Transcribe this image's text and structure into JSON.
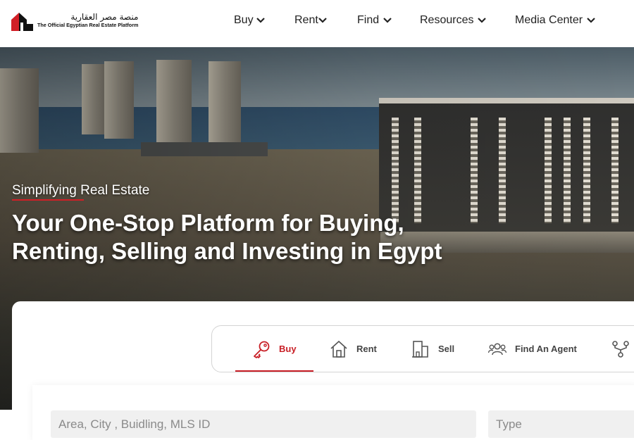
{
  "logo": {
    "arabic": "منصة مصر العقارية",
    "english": "The Official Egyptian Real Estate Platform"
  },
  "nav": {
    "items": [
      {
        "label": "Buy"
      },
      {
        "label": "Rent"
      },
      {
        "label": "Find"
      },
      {
        "label": "Resources"
      },
      {
        "label": "Media Center"
      }
    ]
  },
  "hero": {
    "kicker": "Simplifying Real Estate",
    "title_line1": "Your One-Stop Platform for Buying,",
    "title_line2": "Renting, Selling and Investing in Egypt"
  },
  "tabs": [
    {
      "label": "Buy",
      "icon": "key-icon",
      "active": true
    },
    {
      "label": "Rent",
      "icon": "house-icon",
      "active": false
    },
    {
      "label": "Sell",
      "icon": "building-icon",
      "active": false
    },
    {
      "label": "Find An Agent",
      "icon": "agents-icon",
      "active": false
    },
    {
      "label": "",
      "icon": "branch-icon",
      "active": false
    }
  ],
  "search": {
    "location_placeholder": "Area, City , Buidling, MLS ID",
    "type_placeholder": "Type"
  },
  "colors": {
    "accent": "#c81e25",
    "text": "#222222",
    "field_bg": "#f0f0f0"
  }
}
